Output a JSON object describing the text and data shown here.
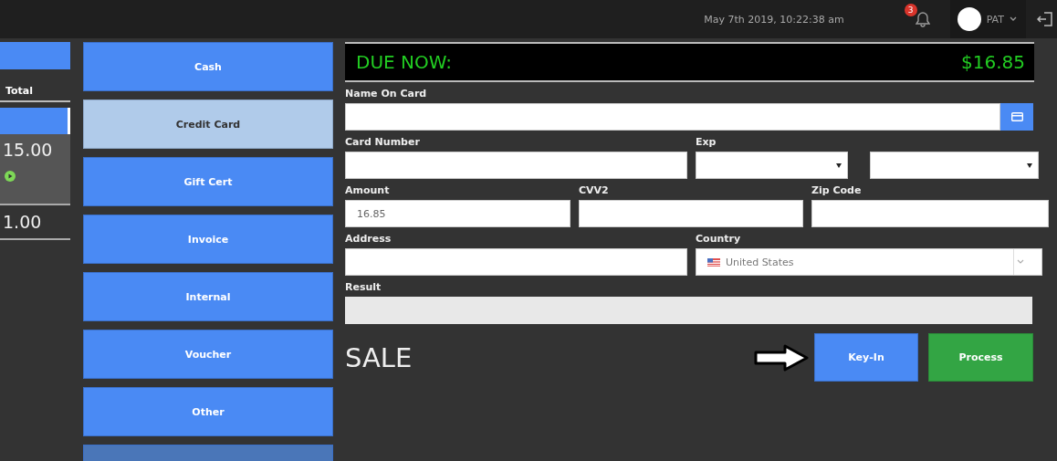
{
  "topbar": {
    "datetime": "May 7th 2019, 10:22:38 am",
    "notification_count": "3",
    "user": "PAT"
  },
  "order": {
    "column": "Total",
    "rows": [
      {
        "total": "15.00",
        "selected": true
      },
      {
        "total": "1.00",
        "selected": false
      }
    ]
  },
  "payment_methods": [
    {
      "label": "Cash",
      "selected": false
    },
    {
      "label": "Credit Card",
      "selected": true
    },
    {
      "label": "Gift Cert",
      "selected": false
    },
    {
      "label": "Invoice",
      "selected": false
    },
    {
      "label": "Internal",
      "selected": false
    },
    {
      "label": "Voucher",
      "selected": false
    },
    {
      "label": "Other",
      "selected": false
    }
  ],
  "due": {
    "label": "DUE NOW:",
    "amount": "$16.85"
  },
  "form": {
    "name_on_card": {
      "label": "Name On Card"
    },
    "card_number": {
      "label": "Card Number"
    },
    "exp": {
      "label": "Exp"
    },
    "amount": {
      "label": "Amount",
      "value": "16.85"
    },
    "cvv2": {
      "label": "CVV2"
    },
    "zip": {
      "label": "Zip Code"
    },
    "address": {
      "label": "Address"
    },
    "country": {
      "label": "Country",
      "value": "United States"
    },
    "result": {
      "label": "Result"
    }
  },
  "transaction_type": "SALE",
  "buttons": [
    {
      "label": "Key-In",
      "kind": "primary"
    },
    {
      "label": "Process",
      "kind": "success"
    }
  ]
}
